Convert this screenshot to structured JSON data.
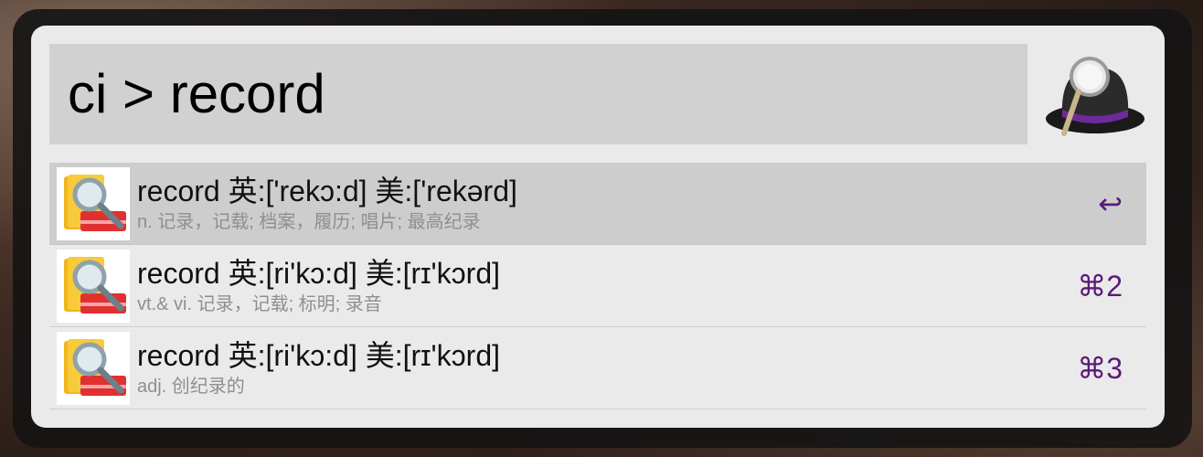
{
  "search": {
    "query": "ci > record"
  },
  "app": {
    "logo_icon": "alfred-hat-magnifier-icon"
  },
  "results": [
    {
      "title": "record 英:['rekɔ:d] 美:['rekərd]",
      "subtitle": "n. 记录，记载; 档案，履历; 唱片; 最高纪录",
      "shortcut": "↩",
      "icon": "dictionary-book-magnifier-icon",
      "selected": true
    },
    {
      "title": "record 英:[ri'kɔ:d] 美:[rɪ'kɔrd]",
      "subtitle": "vt.& vi. 记录，记载; 标明; 录音",
      "shortcut": "⌘2",
      "icon": "dictionary-book-magnifier-icon",
      "selected": false
    },
    {
      "title": "record 英:[ri'kɔ:d] 美:[rɪ'kɔrd]",
      "subtitle": "adj. 创纪录的",
      "shortcut": "⌘3",
      "icon": "dictionary-book-magnifier-icon",
      "selected": false
    }
  ],
  "colors": {
    "window_bg": "#eaeaea",
    "search_bg": "#d1d1d1",
    "selected_row_bg": "#cdcdcd",
    "shortcut_color": "#5a1a7a",
    "subtitle_color": "#8f8f8f"
  }
}
